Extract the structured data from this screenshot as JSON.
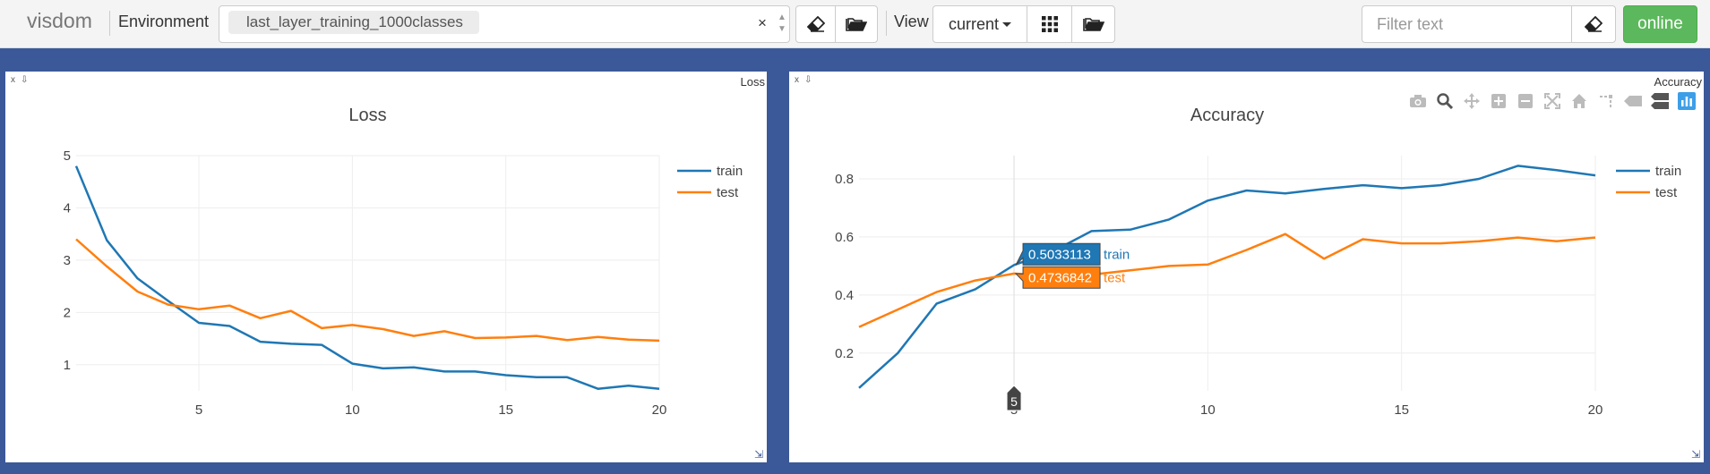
{
  "brand": "visdom",
  "env_label": "Environment",
  "env_tag": "last_layer_training_1000classes",
  "env_clear": "×",
  "view_label": "View",
  "view_value": "current",
  "filter_placeholder": "Filter text",
  "online_label": "online",
  "colors": {
    "train": "#1f77b4",
    "test": "#ff7f0e",
    "background": "#3b5998",
    "online": "#5cb85c"
  },
  "panes": [
    {
      "id": "loss",
      "title_small": "Loss",
      "close": "x",
      "download": "⇩"
    },
    {
      "id": "accuracy",
      "title_small": "Accuracy",
      "close": "x",
      "download": "⇩"
    }
  ],
  "chart_data": [
    {
      "type": "line",
      "title": "Loss",
      "xlabel": "",
      "ylabel": "",
      "xlim": [
        1,
        20
      ],
      "ylim": [
        0.5,
        5.0
      ],
      "xticks": [
        5,
        10,
        15,
        20
      ],
      "yticks": [
        1,
        2,
        3,
        4,
        5
      ],
      "x": [
        1,
        2,
        3,
        4,
        5,
        6,
        7,
        8,
        9,
        10,
        11,
        12,
        13,
        14,
        15,
        16,
        17,
        18,
        19,
        20
      ],
      "series": [
        {
          "name": "train",
          "color": "#1f77b4",
          "values": [
            4.8,
            3.38,
            2.65,
            2.22,
            1.8,
            1.74,
            1.44,
            1.4,
            1.38,
            1.02,
            0.93,
            0.95,
            0.87,
            0.87,
            0.8,
            0.76,
            0.76,
            0.54,
            0.6,
            0.54
          ]
        },
        {
          "name": "test",
          "color": "#ff7f0e",
          "values": [
            3.4,
            2.88,
            2.4,
            2.15,
            2.06,
            2.13,
            1.89,
            2.03,
            1.7,
            1.76,
            1.68,
            1.55,
            1.64,
            1.51,
            1.52,
            1.55,
            1.47,
            1.53,
            1.48,
            1.46
          ]
        }
      ],
      "legend": "top-right",
      "grid": true
    },
    {
      "type": "line",
      "title": "Accuracy",
      "xlabel": "",
      "ylabel": "",
      "xlim": [
        1,
        20
      ],
      "ylim": [
        0.07,
        0.88
      ],
      "xticks": [
        5,
        10,
        15,
        20
      ],
      "yticks": [
        0.2,
        0.4,
        0.6,
        0.8
      ],
      "x": [
        1,
        2,
        3,
        4,
        5,
        6,
        7,
        8,
        9,
        10,
        11,
        12,
        13,
        14,
        15,
        16,
        17,
        18,
        19,
        20
      ],
      "series": [
        {
          "name": "train",
          "color": "#1f77b4",
          "values": [
            0.08,
            0.2,
            0.37,
            0.42,
            0.5033113,
            0.55,
            0.62,
            0.625,
            0.66,
            0.725,
            0.76,
            0.75,
            0.765,
            0.778,
            0.768,
            0.778,
            0.8,
            0.845,
            0.83,
            0.812
          ]
        },
        {
          "name": "test",
          "color": "#ff7f0e",
          "values": [
            0.29,
            0.35,
            0.41,
            0.45,
            0.4736842,
            0.465,
            0.47,
            0.485,
            0.5,
            0.505,
            0.555,
            0.61,
            0.525,
            0.592,
            0.578,
            0.578,
            0.585,
            0.598,
            0.585,
            0.598
          ]
        }
      ],
      "legend": "top-right",
      "grid": true,
      "hover": {
        "x": 5,
        "x_label": "5",
        "values": [
          "0.5033113",
          "0.4736842"
        ],
        "labels": [
          "train",
          "test"
        ]
      }
    }
  ]
}
